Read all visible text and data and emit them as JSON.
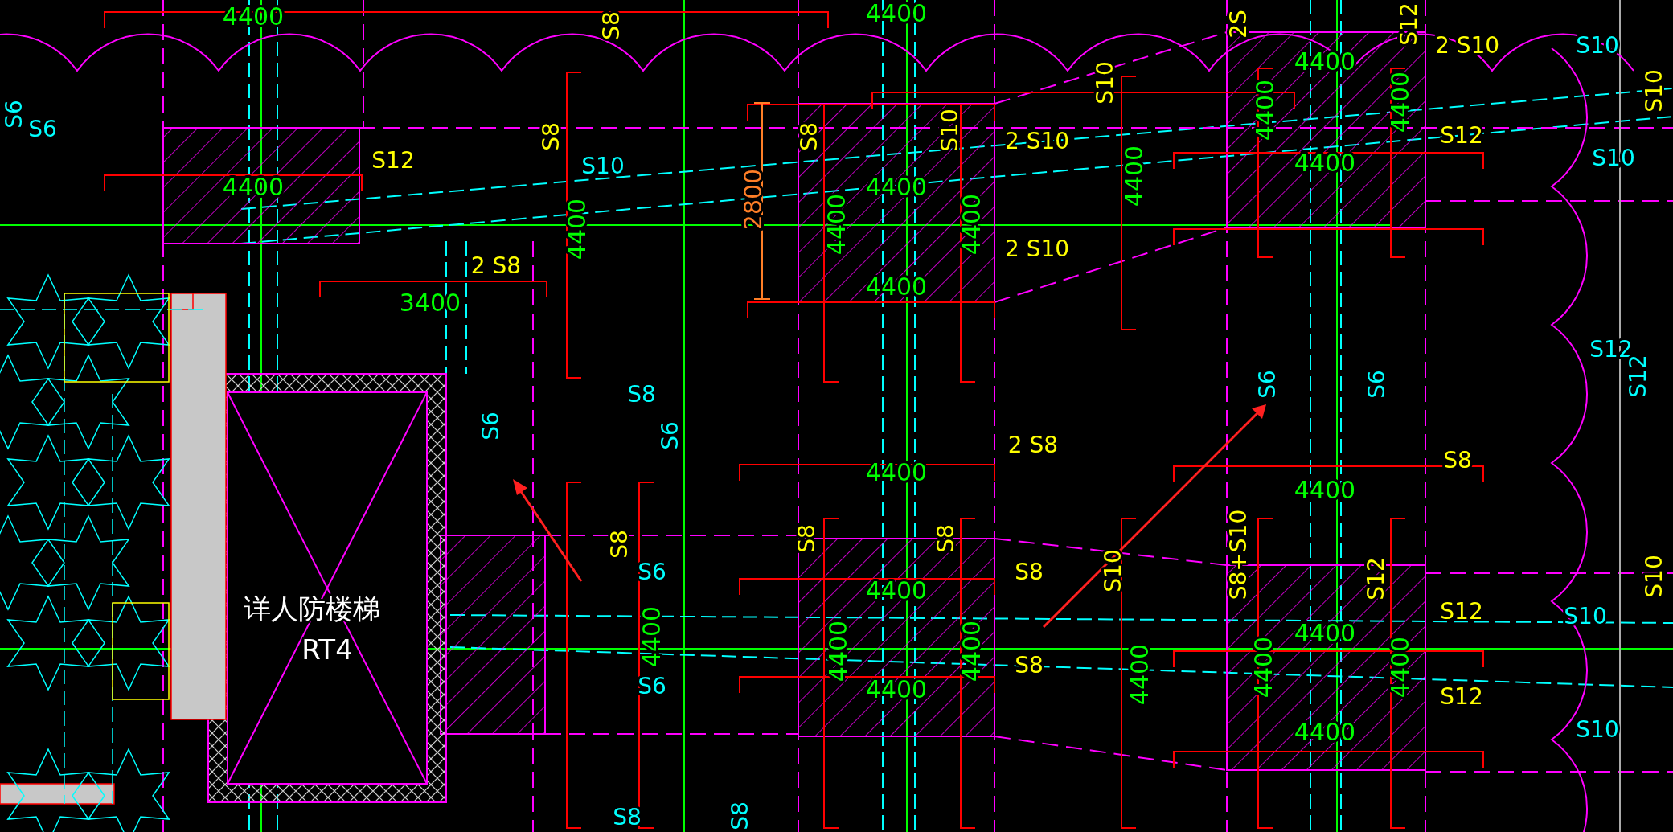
{
  "drawing": {
    "labels": [
      {
        "text": "4400",
        "color": "#00ff00",
        "kind": "dimension"
      },
      {
        "text": "S6",
        "color": "#00ffff",
        "kind": "rebar"
      },
      {
        "text": "S12",
        "color": "#ffff00",
        "kind": "rebar"
      },
      {
        "text": "4400",
        "color": "#00ff00",
        "kind": "dimension"
      },
      {
        "text": "S10",
        "color": "#00ffff",
        "kind": "rebar"
      },
      {
        "text": "2 S8",
        "color": "#ffff00",
        "kind": "rebar"
      },
      {
        "text": "3400",
        "color": "#00ff00",
        "kind": "dimension"
      },
      {
        "text": "S8",
        "color": "#00ffff",
        "kind": "rebar"
      },
      {
        "text": "4400",
        "color": "#00ff00",
        "kind": "dimension"
      },
      {
        "text": "4400",
        "color": "#00ff00",
        "kind": "dimension"
      },
      {
        "text": "4400",
        "color": "#00ff00",
        "kind": "dimension"
      },
      {
        "text": "2 S10",
        "color": "#ffff00",
        "kind": "rebar"
      },
      {
        "text": "2 S10",
        "color": "#ffff00",
        "kind": "rebar"
      },
      {
        "text": "2 S10",
        "color": "#ffff00",
        "kind": "rebar"
      },
      {
        "text": "4400",
        "color": "#00ff00",
        "kind": "dimension"
      },
      {
        "text": "4400",
        "color": "#00ff00",
        "kind": "dimension"
      },
      {
        "text": "S12",
        "color": "#ffff00",
        "kind": "rebar"
      },
      {
        "text": "S10",
        "color": "#00ffff",
        "kind": "rebar"
      },
      {
        "text": "S10",
        "color": "#00ffff",
        "kind": "rebar"
      },
      {
        "text": "S12",
        "color": "#00ffff",
        "kind": "rebar"
      },
      {
        "text": "2 S8",
        "color": "#ffff00",
        "kind": "rebar"
      },
      {
        "text": "4400",
        "color": "#00ff00",
        "kind": "dimension"
      },
      {
        "text": "S8",
        "color": "#ffff00",
        "kind": "rebar"
      },
      {
        "text": "4400",
        "color": "#00ff00",
        "kind": "dimension"
      },
      {
        "text": "S8",
        "color": "#ffff00",
        "kind": "rebar"
      },
      {
        "text": "4400",
        "color": "#00ff00",
        "kind": "dimension"
      },
      {
        "text": "S8",
        "color": "#ffff00",
        "kind": "rebar"
      },
      {
        "text": "4400",
        "color": "#00ff00",
        "kind": "dimension"
      },
      {
        "text": "S12",
        "color": "#ffff00",
        "kind": "rebar"
      },
      {
        "text": "S12",
        "color": "#ffff00",
        "kind": "rebar"
      },
      {
        "text": "4400",
        "color": "#00ff00",
        "kind": "dimension"
      },
      {
        "text": "4400",
        "color": "#00ff00",
        "kind": "dimension"
      },
      {
        "text": "S10",
        "color": "#00ffff",
        "kind": "rebar"
      },
      {
        "text": "S10",
        "color": "#00ffff",
        "kind": "rebar"
      },
      {
        "text": "S6",
        "color": "#00ffff",
        "kind": "rebar"
      },
      {
        "text": "S6",
        "color": "#00ffff",
        "kind": "rebar"
      },
      {
        "text": "S8",
        "color": "#00ffff",
        "kind": "rebar"
      },
      {
        "text": "详人防楼梯",
        "color": "#ffffff",
        "kind": "note"
      },
      {
        "text": "RT4",
        "color": "#ffffff",
        "kind": "note"
      },
      {
        "text": "S6",
        "color": "#00ffff",
        "kind": "rebar"
      },
      {
        "text": "S8",
        "color": "#ffff00",
        "kind": "rebar"
      },
      {
        "text": "4400",
        "color": "#00ff00",
        "kind": "dimension"
      },
      {
        "text": "S8",
        "color": "#ffff00",
        "kind": "rebar"
      },
      {
        "text": "S10",
        "color": "#ffff00",
        "kind": "rebar"
      },
      {
        "text": "2800",
        "color": "#ff7f27",
        "kind": "dimension"
      },
      {
        "text": "4400",
        "color": "#00ff00",
        "kind": "dimension"
      },
      {
        "text": "4400",
        "color": "#00ff00",
        "kind": "dimension"
      },
      {
        "text": "S10",
        "color": "#ffff00",
        "kind": "rebar"
      },
      {
        "text": "4400",
        "color": "#00ff00",
        "kind": "dimension"
      },
      {
        "text": "2S",
        "color": "#ffff00",
        "kind": "rebar"
      },
      {
        "text": "S12",
        "color": "#ffff00",
        "kind": "rebar"
      },
      {
        "text": "4400",
        "color": "#00ff00",
        "kind": "dimension"
      },
      {
        "text": "4400",
        "color": "#00ff00",
        "kind": "dimension"
      },
      {
        "text": "S8",
        "color": "#ffff00",
        "kind": "rebar"
      },
      {
        "text": "S6",
        "color": "#00ffff",
        "kind": "rebar"
      },
      {
        "text": "S6",
        "color": "#00ffff",
        "kind": "rebar"
      },
      {
        "text": "S6",
        "color": "#00ffff",
        "kind": "rebar"
      },
      {
        "text": "S6",
        "color": "#00ffff",
        "kind": "rebar"
      },
      {
        "text": "S8",
        "color": "#ffff00",
        "kind": "rebar"
      },
      {
        "text": "4400",
        "color": "#00ff00",
        "kind": "dimension"
      },
      {
        "text": "S8",
        "color": "#ffff00",
        "kind": "rebar"
      },
      {
        "text": "S8",
        "color": "#ffff00",
        "kind": "rebar"
      },
      {
        "text": "4400",
        "color": "#00ff00",
        "kind": "dimension"
      },
      {
        "text": "4400",
        "color": "#00ff00",
        "kind": "dimension"
      },
      {
        "text": "S10",
        "color": "#ffff00",
        "kind": "rebar"
      },
      {
        "text": "4400",
        "color": "#00ff00",
        "kind": "dimension"
      },
      {
        "text": "S8+S10",
        "color": "#ffff00",
        "kind": "rebar"
      },
      {
        "text": "S12",
        "color": "#ffff00",
        "kind": "rebar"
      },
      {
        "text": "4400",
        "color": "#00ff00",
        "kind": "dimension"
      },
      {
        "text": "4400",
        "color": "#00ff00",
        "kind": "dimension"
      },
      {
        "text": "S12",
        "color": "#00ffff",
        "kind": "rebar"
      },
      {
        "text": "S10",
        "color": "#ffff00",
        "kind": "rebar"
      },
      {
        "text": "S10",
        "color": "#ffff00",
        "kind": "rebar"
      },
      {
        "text": "S8",
        "color": "#00ffff",
        "kind": "rebar"
      }
    ]
  }
}
